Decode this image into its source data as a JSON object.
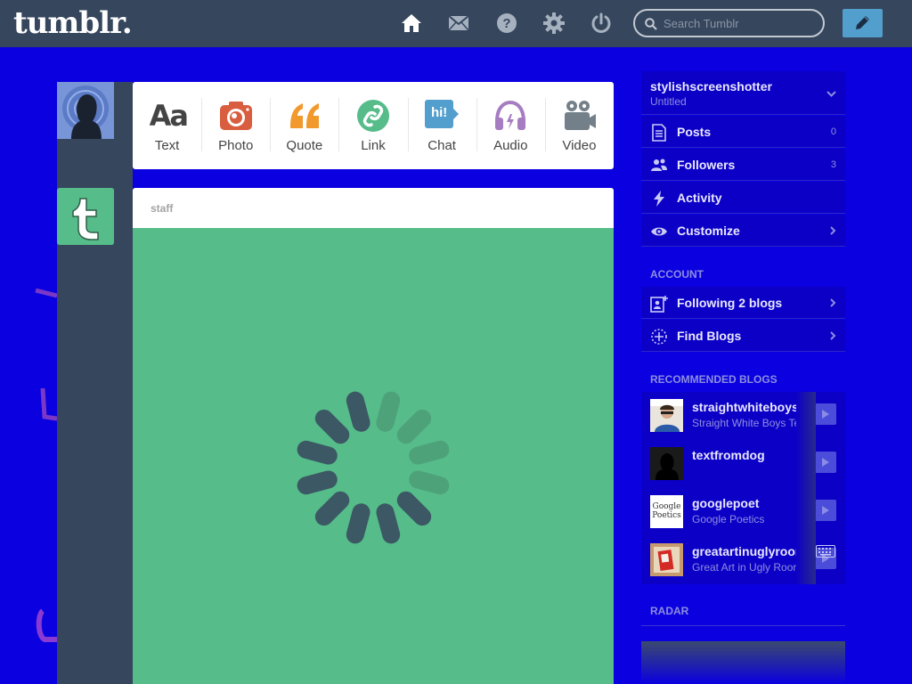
{
  "header": {
    "logo": "tumblr.",
    "nav_icons": [
      "home-icon",
      "mail-icon",
      "help-icon",
      "gear-icon",
      "power-icon"
    ],
    "search_placeholder": "Search Tumblr"
  },
  "post_types": [
    {
      "label": "Text",
      "icon": "text-icon",
      "glyph": "Aa",
      "color": "#444444"
    },
    {
      "label": "Photo",
      "icon": "camera-icon",
      "color": "#d95e40"
    },
    {
      "label": "Quote",
      "icon": "quote-icon",
      "color": "#f2992e"
    },
    {
      "label": "Link",
      "icon": "link-icon",
      "color": "#56bc8a"
    },
    {
      "label": "Chat",
      "icon": "chat-icon",
      "glyph": "hi!",
      "color": "#529ecc"
    },
    {
      "label": "Audio",
      "icon": "headphones-icon",
      "color": "#a77dc2"
    },
    {
      "label": "Video",
      "icon": "video-camera-icon",
      "color": "#748089"
    }
  ],
  "post": {
    "author": "staff",
    "background_color": "#56bc8a"
  },
  "sidebar": {
    "blog": {
      "name": "stylishscreenshotter",
      "subtitle": "Untitled"
    },
    "items": [
      {
        "label": "Posts",
        "count": "0",
        "icon": "posts-icon"
      },
      {
        "label": "Followers",
        "count": "3",
        "icon": "followers-icon"
      },
      {
        "label": "Activity",
        "icon": "lightning-icon"
      },
      {
        "label": "Customize",
        "icon": "eye-icon"
      }
    ],
    "account_title": "ACCOUNT",
    "account_items": [
      {
        "label": "Following 2 blogs",
        "icon": "following-icon"
      },
      {
        "label": "Find Blogs",
        "icon": "find-blogs-icon"
      }
    ],
    "recommended_title": "RECOMMENDED BLOGS",
    "recommended": [
      {
        "name": "straightwhiteboyste",
        "subtitle": "Straight White Boys Te"
      },
      {
        "name": "textfromdog",
        "subtitle": ""
      },
      {
        "name": "googlepoet",
        "subtitle": "Google Poetics"
      },
      {
        "name": "greatartinuglyroom",
        "subtitle": "Great Art in Ugly Roor"
      }
    ],
    "thumb_googlepoet_line1": "Google",
    "thumb_googlepoet_line2": "Poetics",
    "radar_title": "RADAR"
  },
  "colors": {
    "page_bg": "#0a00e0",
    "header_bg": "#36465d",
    "accent_blue": "#529ecc",
    "staff_green": "#56bc8a"
  }
}
